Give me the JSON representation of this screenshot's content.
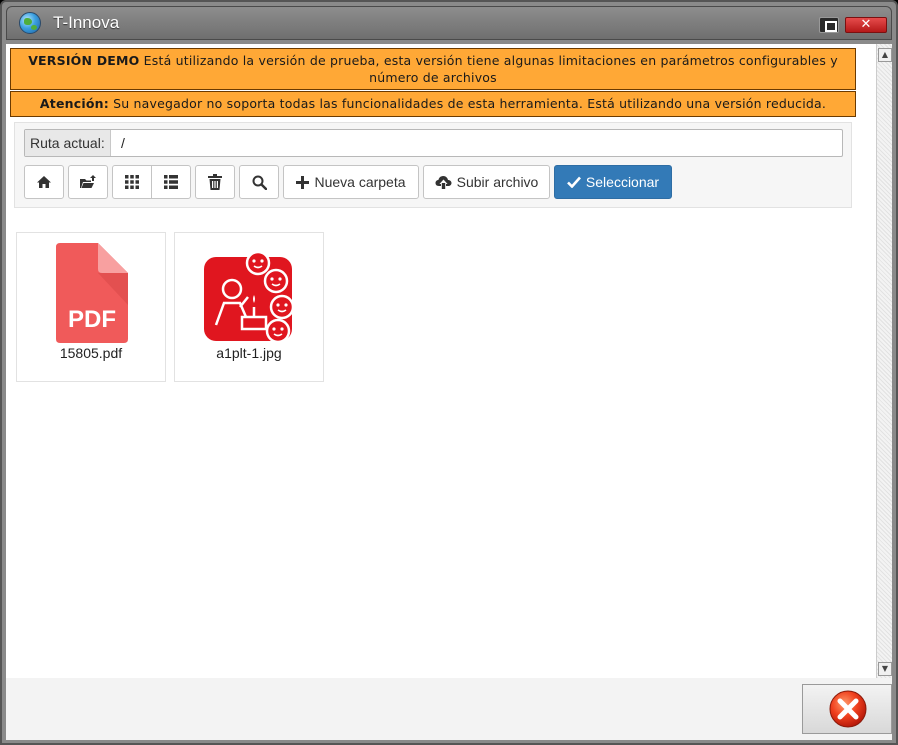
{
  "window": {
    "title": "T-Innova",
    "close_glyph": "✕"
  },
  "banners": {
    "demo_label": "VERSIÓN DEMO",
    "demo_text": " Está utilizando la versión de prueba, esta versión tiene algunas limitaciones en parámetros configurables y número de archivos",
    "warning_label": "Atención:",
    "warning_text": " Su navegador no soporta todas las funcionalidades de esta herramienta. Está utilizando una versión reducida."
  },
  "path": {
    "label": "Ruta actual:",
    "value": "/"
  },
  "toolbar": {
    "icons": [
      "home-icon",
      "parent-folder-icon",
      "grid-view-icon",
      "list-view-icon",
      "trash-icon",
      "search-icon"
    ],
    "new_folder": "Nueva carpeta",
    "upload_file": "Subir archivo",
    "select": "Seleccionar"
  },
  "files": [
    {
      "name": "15805.pdf",
      "type": "pdf",
      "badge": "PDF",
      "icon": "pdf-file-icon"
    },
    {
      "name": "a1plt-1.jpg",
      "type": "jpg",
      "icon": "image-thumbnail-icon"
    }
  ],
  "colors": {
    "banner": "#ffa836",
    "primary": "#337ab7",
    "pdf": "#f05a5a",
    "thumb": "#e0161f"
  }
}
